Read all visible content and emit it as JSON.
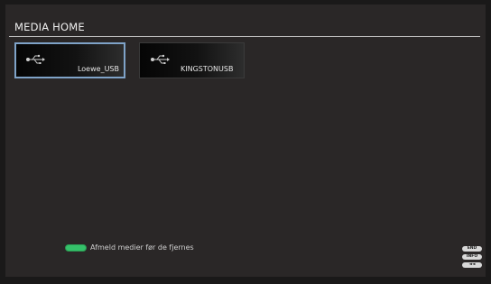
{
  "header": {
    "title": "MEDIA HOME"
  },
  "devices": [
    {
      "label": "Loewe_USB",
      "icon": "usb-icon",
      "selected": true
    },
    {
      "label": "KINGSTONUSB",
      "icon": "usb-icon",
      "selected": false
    }
  ],
  "footer": {
    "hint_key": "green-key",
    "hint_text": "Afmeld medier før de fjernes",
    "keys": [
      "END",
      "INFO",
      "◄◄"
    ]
  },
  "colors": {
    "background": "#2a2727",
    "selection_border": "#7fa3c8",
    "green_key": "#35c16a"
  }
}
